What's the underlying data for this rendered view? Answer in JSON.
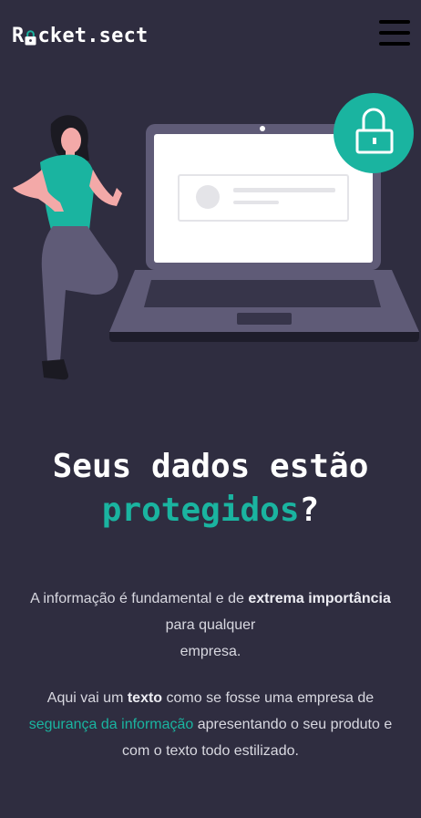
{
  "header": {
    "logo_part1": "R",
    "logo_part2": "cket.sect",
    "menu_icon": "hamburger-menu-icon"
  },
  "hero": {
    "illustration": "woman-leaning-on-laptop-with-lock",
    "lock_icon": "padlock-icon",
    "colors": {
      "accent": "#1ab4a0",
      "background": "#2f2d40"
    }
  },
  "headline": {
    "line1": "Seus dados estão",
    "accent": "protegidos",
    "suffix": "?"
  },
  "intro": {
    "part1": "A informação é fundamental e de ",
    "bold": "extrema importância",
    "part2": " para qualquer",
    "part3": "empresa."
  },
  "description": {
    "part1": "Aqui vai um ",
    "bold": "texto",
    "part2": " como se fosse uma empresa de",
    "link": "segurança da informação",
    "part3": " apresentando o seu produto e",
    "part4": "com o texto todo estilizado."
  }
}
